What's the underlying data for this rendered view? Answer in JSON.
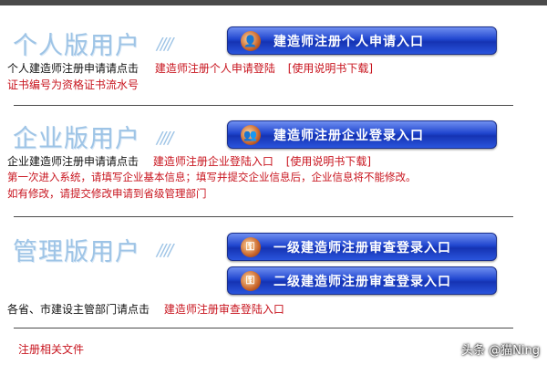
{
  "personal": {
    "title": "个人版用户",
    "slashes": "////",
    "button_label": "建造师注册个人申请入口",
    "prompt_text": "个人建造师注册申请请点击",
    "login_link": "建造师注册个人申请登陆",
    "manual_link": "[使用说明书下载]",
    "note": "证书编号为资格证书流水号"
  },
  "enterprise": {
    "title": "企业版用户",
    "slashes": "////",
    "button_label": "建造师注册企业登录入口",
    "prompt_text": "企业建造师注册申请请点击",
    "login_link": "建造师注册企业登陆入口",
    "manual_link": "[使用说明书下载]",
    "note_line1": "第一次进入系统，请填写企业基本信息；填写并提交企业信息后，企业信息将不能修改。",
    "note_line2": "如有修改，请提交修改申请到省级管理部门"
  },
  "admin": {
    "title": "管理版用户",
    "slashes": "////",
    "button1_label": "一级建造师注册审查登录入口",
    "button2_label": "二级建造师注册审查登录入口",
    "prompt_text": "各省、市建设主管部门请点击",
    "login_link": "建造师注册审查登陆入口"
  },
  "footer": {
    "related_docs": "注册相关文件"
  },
  "watermark": "头条 @猫Ning",
  "colors": {
    "accent_red": "#c8141e",
    "title_blue": "#9ec4e6",
    "button_blue": "#2046cf"
  }
}
